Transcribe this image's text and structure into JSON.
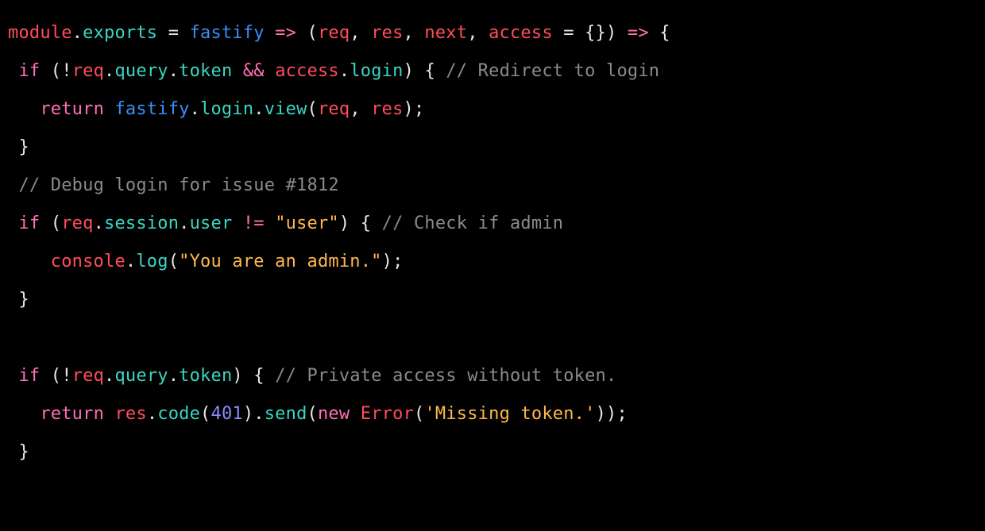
{
  "colorMap": {
    "default": "c-default",
    "red": "c-red",
    "teal": "c-teal",
    "pink": "c-pink",
    "blue": "c-blue",
    "orange": "c-orange",
    "num": "c-num",
    "comment": "c-comment"
  },
  "lines": [
    [
      {
        "t": "module",
        "c": "red"
      },
      {
        "t": ".",
        "c": "default"
      },
      {
        "t": "exports",
        "c": "teal"
      },
      {
        "t": " = ",
        "c": "default"
      },
      {
        "t": "fastify",
        "c": "blue"
      },
      {
        "t": " ",
        "c": "default"
      },
      {
        "t": "=>",
        "c": "pink"
      },
      {
        "t": " (",
        "c": "default"
      },
      {
        "t": "req",
        "c": "red"
      },
      {
        "t": ", ",
        "c": "default"
      },
      {
        "t": "res",
        "c": "red"
      },
      {
        "t": ", ",
        "c": "default"
      },
      {
        "t": "next",
        "c": "red"
      },
      {
        "t": ", ",
        "c": "default"
      },
      {
        "t": "access",
        "c": "red"
      },
      {
        "t": " = {}) ",
        "c": "default"
      },
      {
        "t": "=>",
        "c": "pink"
      },
      {
        "t": " {",
        "c": "default"
      }
    ],
    [
      {
        "t": " ",
        "c": "default"
      },
      {
        "t": "if",
        "c": "pink"
      },
      {
        "t": " (!",
        "c": "default"
      },
      {
        "t": "req",
        "c": "red"
      },
      {
        "t": ".",
        "c": "default"
      },
      {
        "t": "query",
        "c": "teal"
      },
      {
        "t": ".",
        "c": "default"
      },
      {
        "t": "token",
        "c": "teal"
      },
      {
        "t": " ",
        "c": "default"
      },
      {
        "t": "&&",
        "c": "pink"
      },
      {
        "t": " ",
        "c": "default"
      },
      {
        "t": "access",
        "c": "red"
      },
      {
        "t": ".",
        "c": "default"
      },
      {
        "t": "login",
        "c": "teal"
      },
      {
        "t": ") { ",
        "c": "default"
      },
      {
        "t": "// Redirect to login",
        "c": "comment"
      }
    ],
    [
      {
        "t": "   ",
        "c": "default"
      },
      {
        "t": "return",
        "c": "pink"
      },
      {
        "t": " ",
        "c": "default"
      },
      {
        "t": "fastify",
        "c": "blue"
      },
      {
        "t": ".",
        "c": "default"
      },
      {
        "t": "login",
        "c": "teal"
      },
      {
        "t": ".",
        "c": "default"
      },
      {
        "t": "view",
        "c": "teal"
      },
      {
        "t": "(",
        "c": "default"
      },
      {
        "t": "req",
        "c": "red"
      },
      {
        "t": ", ",
        "c": "default"
      },
      {
        "t": "res",
        "c": "red"
      },
      {
        "t": ");",
        "c": "default"
      }
    ],
    [
      {
        "t": " }",
        "c": "default"
      }
    ],
    [
      {
        "t": " ",
        "c": "default"
      },
      {
        "t": "// Debug login for issue #1812",
        "c": "comment"
      }
    ],
    [
      {
        "t": " ",
        "c": "default"
      },
      {
        "t": "if",
        "c": "pink"
      },
      {
        "t": " (",
        "c": "default"
      },
      {
        "t": "req",
        "c": "red"
      },
      {
        "t": ".",
        "c": "default"
      },
      {
        "t": "session",
        "c": "teal"
      },
      {
        "t": ".",
        "c": "default"
      },
      {
        "t": "user",
        "c": "teal"
      },
      {
        "t": " ",
        "c": "default"
      },
      {
        "t": "!=",
        "c": "pink"
      },
      {
        "t": " ",
        "c": "default"
      },
      {
        "t": "\"user\"",
        "c": "orange"
      },
      {
        "t": ") { ",
        "c": "default"
      },
      {
        "t": "// Check if admin",
        "c": "comment"
      }
    ],
    [
      {
        "t": "    ",
        "c": "default"
      },
      {
        "t": "console",
        "c": "red"
      },
      {
        "t": ".",
        "c": "default"
      },
      {
        "t": "log",
        "c": "teal"
      },
      {
        "t": "(",
        "c": "default"
      },
      {
        "t": "\"You are an admin.\"",
        "c": "orange"
      },
      {
        "t": ");",
        "c": "default"
      }
    ],
    [
      {
        "t": " }",
        "c": "default"
      }
    ],
    [
      {
        "t": "",
        "c": "default"
      }
    ],
    [
      {
        "t": " ",
        "c": "default"
      },
      {
        "t": "if",
        "c": "pink"
      },
      {
        "t": " (!",
        "c": "default"
      },
      {
        "t": "req",
        "c": "red"
      },
      {
        "t": ".",
        "c": "default"
      },
      {
        "t": "query",
        "c": "teal"
      },
      {
        "t": ".",
        "c": "default"
      },
      {
        "t": "token",
        "c": "teal"
      },
      {
        "t": ") { ",
        "c": "default"
      },
      {
        "t": "// Private access without token.",
        "c": "comment"
      }
    ],
    [
      {
        "t": "   ",
        "c": "default"
      },
      {
        "t": "return",
        "c": "pink"
      },
      {
        "t": " ",
        "c": "default"
      },
      {
        "t": "res",
        "c": "red"
      },
      {
        "t": ".",
        "c": "default"
      },
      {
        "t": "code",
        "c": "teal"
      },
      {
        "t": "(",
        "c": "default"
      },
      {
        "t": "401",
        "c": "num"
      },
      {
        "t": ").",
        "c": "default"
      },
      {
        "t": "send",
        "c": "teal"
      },
      {
        "t": "(",
        "c": "default"
      },
      {
        "t": "new",
        "c": "pink"
      },
      {
        "t": " ",
        "c": "default"
      },
      {
        "t": "Error",
        "c": "red"
      },
      {
        "t": "(",
        "c": "default"
      },
      {
        "t": "'Missing token.'",
        "c": "orange"
      },
      {
        "t": "));",
        "c": "default"
      }
    ],
    [
      {
        "t": " }",
        "c": "default"
      }
    ]
  ]
}
